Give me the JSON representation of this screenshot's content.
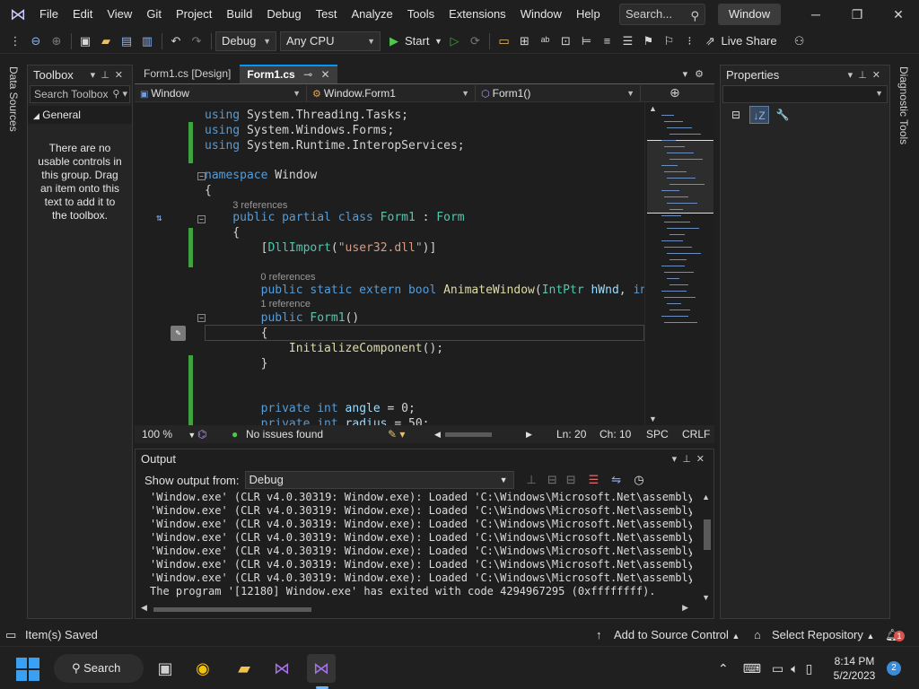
{
  "menu": {
    "items": [
      "File",
      "Edit",
      "View",
      "Git",
      "Project",
      "Build",
      "Debug",
      "Test",
      "Analyze",
      "Tools",
      "Extensions",
      "Window",
      "Help"
    ],
    "search_placeholder": "Search...",
    "solution_name": "Window"
  },
  "toolbar": {
    "configuration": "Debug",
    "platform": "Any CPU",
    "start_label": "Start",
    "live_share": "Live Share"
  },
  "side_strips": {
    "left": "Data Sources",
    "right": "Diagnostic Tools"
  },
  "toolbox": {
    "title": "Toolbox",
    "search_placeholder": "Search Toolbox",
    "group": "General",
    "empty_message": "There are no usable controls in this group. Drag an item onto this text to add it to the toolbox."
  },
  "tabs": [
    {
      "label": "Form1.cs [Design]"
    },
    {
      "label": "Form1.cs"
    }
  ],
  "nav_bar": {
    "project": "Window",
    "type": "Window.Form1",
    "member": "Form1()"
  },
  "code": {
    "lines": [
      {
        "tokens": [
          [
            "kw",
            "using "
          ],
          [
            "",
            "System.Threading.Tasks;"
          ]
        ]
      },
      {
        "tokens": [
          [
            "kw",
            "using "
          ],
          [
            "",
            "System.Windows.Forms;"
          ]
        ]
      },
      {
        "tokens": [
          [
            "kw",
            "using "
          ],
          [
            "",
            "System.Runtime.InteropServices;"
          ]
        ]
      },
      {
        "tokens": [
          [
            "kw",
            "namespace "
          ],
          [
            "",
            "Window"
          ]
        ]
      },
      {
        "tokens": [
          [
            "",
            "{"
          ]
        ]
      },
      {
        "tokens": [
          [
            "kw",
            "    public partial class "
          ],
          [
            "ty",
            "Form1"
          ],
          [
            "",
            " : "
          ],
          [
            "ty",
            "Form"
          ]
        ]
      },
      {
        "tokens": [
          [
            "",
            "    {"
          ]
        ]
      },
      {
        "tokens": [
          [
            "",
            "        ["
          ],
          [
            "ty",
            "DllImport"
          ],
          [
            "",
            "("
          ],
          [
            "str",
            "\"user32.dll\""
          ],
          [
            "",
            ")]"
          ]
        ]
      },
      {
        "tokens": [
          [
            "kw",
            "        public static extern bool "
          ],
          [
            "fn",
            "AnimateWindow"
          ],
          [
            "",
            "("
          ],
          [
            "ty",
            "IntPtr"
          ],
          [
            "",
            " "
          ],
          [
            "id",
            "hWnd"
          ],
          [
            "",
            ", "
          ],
          [
            "kw",
            "int"
          ]
        ]
      },
      {
        "tokens": [
          [
            "kw",
            "        public "
          ],
          [
            "ty",
            "Form1"
          ],
          [
            "",
            "()"
          ]
        ]
      },
      {
        "tokens": [
          [
            "",
            "        {"
          ]
        ]
      },
      {
        "tokens": [
          [
            "",
            "            "
          ],
          [
            "fn",
            "InitializeComponent"
          ],
          [
            "",
            "();"
          ]
        ]
      },
      {
        "tokens": [
          [
            "",
            "        }"
          ]
        ]
      },
      {
        "tokens": [
          [
            "kw",
            "        private int "
          ],
          [
            "id",
            "angle"
          ],
          [
            "",
            " = 0;"
          ]
        ]
      },
      {
        "tokens": [
          [
            "kw",
            "        private int "
          ],
          [
            "id",
            "radius"
          ],
          [
            "",
            " = 50;"
          ]
        ]
      }
    ],
    "refs": [
      "3 references",
      "0 references",
      "1 reference"
    ]
  },
  "editor_status": {
    "zoom": "100 %",
    "issues": "No issues found",
    "line": "Ln: 20",
    "col": "Ch: 10",
    "spacing": "SPC",
    "line_ending": "CRLF"
  },
  "output": {
    "title": "Output",
    "show_from_label": "Show output from:",
    "source": "Debug",
    "lines": [
      "'Window.exe' (CLR v4.0.30319: Window.exe): Loaded 'C:\\Windows\\Microsoft.Net\\assembly\\GA",
      "'Window.exe' (CLR v4.0.30319: Window.exe): Loaded 'C:\\Windows\\Microsoft.Net\\assembly\\GA",
      "'Window.exe' (CLR v4.0.30319: Window.exe): Loaded 'C:\\Windows\\Microsoft.Net\\assembly\\GA",
      "'Window.exe' (CLR v4.0.30319: Window.exe): Loaded 'C:\\Windows\\Microsoft.Net\\assembly\\GA",
      "'Window.exe' (CLR v4.0.30319: Window.exe): Loaded 'C:\\Windows\\Microsoft.Net\\assembly\\GA",
      "'Window.exe' (CLR v4.0.30319: Window.exe): Loaded 'C:\\Windows\\Microsoft.Net\\assembly\\GA",
      "'Window.exe' (CLR v4.0.30319: Window.exe): Loaded 'C:\\Windows\\Microsoft.Net\\assembly\\GA",
      "The program '[12180] Window.exe' has exited with code 4294967295 (0xffffffff)."
    ]
  },
  "properties": {
    "title": "Properties"
  },
  "app_status": {
    "message": "Item(s) Saved",
    "source_control": "Add to Source Control",
    "repository": "Select Repository",
    "notification_count": "1"
  },
  "taskbar": {
    "search_label": "Search",
    "time": "8:14 PM",
    "date": "5/2/2023",
    "notification_count": "2"
  },
  "colors": {
    "accent": "#007acc",
    "keyword": "#569cd6",
    "type": "#4ec9b0",
    "string": "#d69d85",
    "method": "#dcdcaa",
    "change_bar": "#3ea33e"
  }
}
